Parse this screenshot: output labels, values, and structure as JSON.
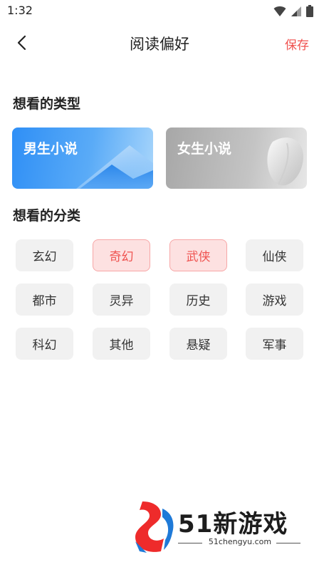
{
  "status_bar": {
    "time": "1:32"
  },
  "header": {
    "title": "阅读偏好",
    "save_label": "保存"
  },
  "sections": {
    "type_title": "想看的类型",
    "category_title": "想看的分类"
  },
  "types": [
    {
      "label": "男生小说",
      "selected": true
    },
    {
      "label": "女生小说",
      "selected": false
    }
  ],
  "categories": [
    {
      "label": "玄幻",
      "selected": false
    },
    {
      "label": "奇幻",
      "selected": true
    },
    {
      "label": "武侠",
      "selected": true
    },
    {
      "label": "仙侠",
      "selected": false
    },
    {
      "label": "都市",
      "selected": false
    },
    {
      "label": "灵异",
      "selected": false
    },
    {
      "label": "历史",
      "selected": false
    },
    {
      "label": "游戏",
      "selected": false
    },
    {
      "label": "科幻",
      "selected": false
    },
    {
      "label": "其他",
      "selected": false
    },
    {
      "label": "悬疑",
      "selected": false
    },
    {
      "label": "军事",
      "selected": false
    }
  ],
  "watermark": {
    "brand": "51新游戏",
    "url": "51chengyu.com"
  },
  "colors": {
    "accent": "#f0524f",
    "selected_bg": "#fde1e1",
    "tag_bg": "#f1f1f1"
  }
}
